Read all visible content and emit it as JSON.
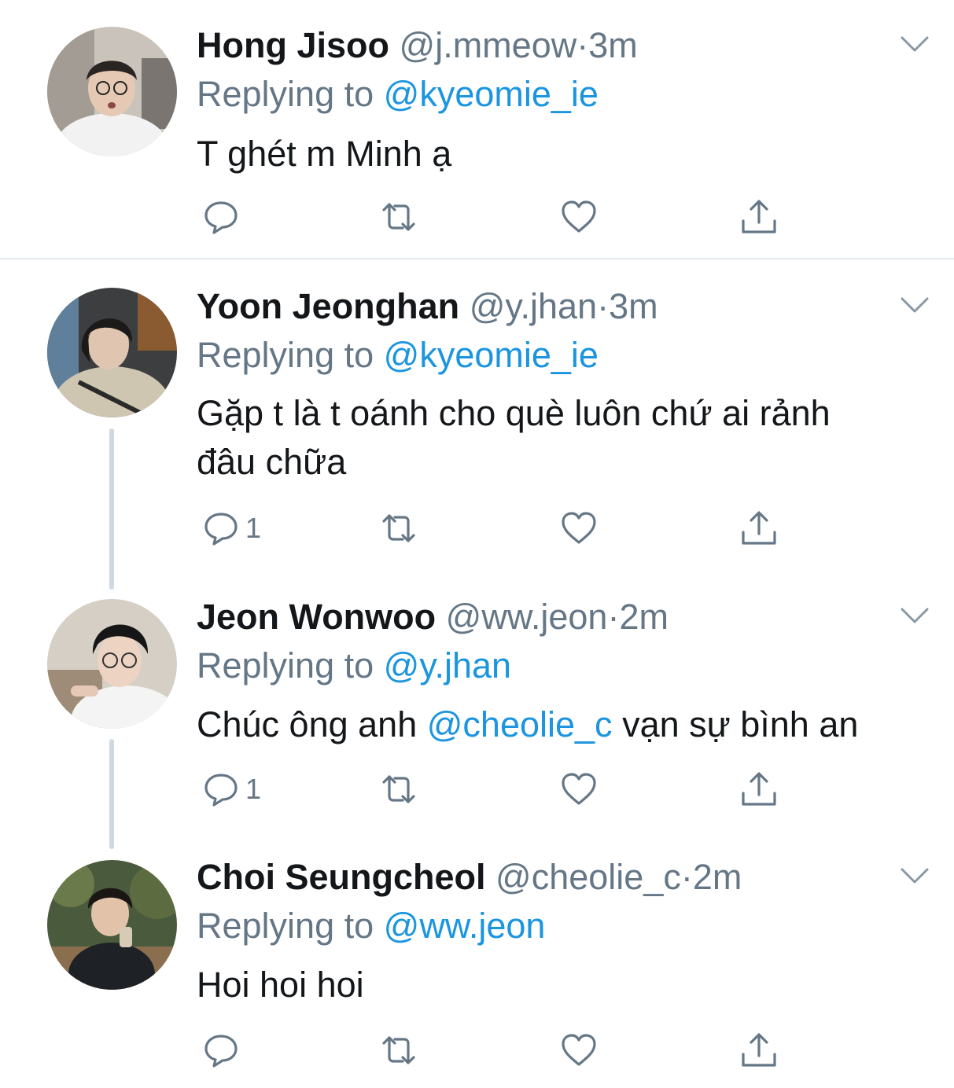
{
  "colors": {
    "mention": "#1b95e0",
    "secondary_text": "#657786",
    "primary_text": "#14171a",
    "thread_line": "#cfd9e2",
    "divider": "#e1e8ed"
  },
  "tweets": [
    {
      "display_name": "Hong Jisoo",
      "handle": "@j.mmeow",
      "separator": "·",
      "time": "3m",
      "replying_prefix": "Replying to",
      "replying_to": "@kyeomie_ie",
      "text": "T ghét m Minh ạ",
      "reply_count": "",
      "icons": [
        "reply-icon",
        "retweet-icon",
        "like-icon",
        "share-icon",
        "chevron-down-icon"
      ]
    },
    {
      "display_name": "Yoon Jeonghan",
      "handle": "@y.jhan",
      "separator": "·",
      "time": "3m",
      "replying_prefix": "Replying to",
      "replying_to": "@kyeomie_ie",
      "text_line1": "Gặp t là t oánh cho què luôn chứ ai rảnh",
      "text_line2": "đâu chữa",
      "reply_count": "1"
    },
    {
      "display_name": "Jeon Wonwoo",
      "handle": "@ww.jeon",
      "separator": "·",
      "time": "2m",
      "replying_prefix": "Replying to",
      "replying_to": "@y.jhan",
      "text_before": "Chúc ông anh",
      "text_mention": "@cheolie_c",
      "text_after": "vạn sự bình an",
      "reply_count": "1"
    },
    {
      "display_name": "Choi Seungcheol",
      "handle": "@cheolie_c",
      "separator": "·",
      "time": "2m",
      "replying_prefix": "Replying to",
      "replying_to": "@ww.jeon",
      "text": "Hoi hoi hoi",
      "reply_count": ""
    }
  ]
}
